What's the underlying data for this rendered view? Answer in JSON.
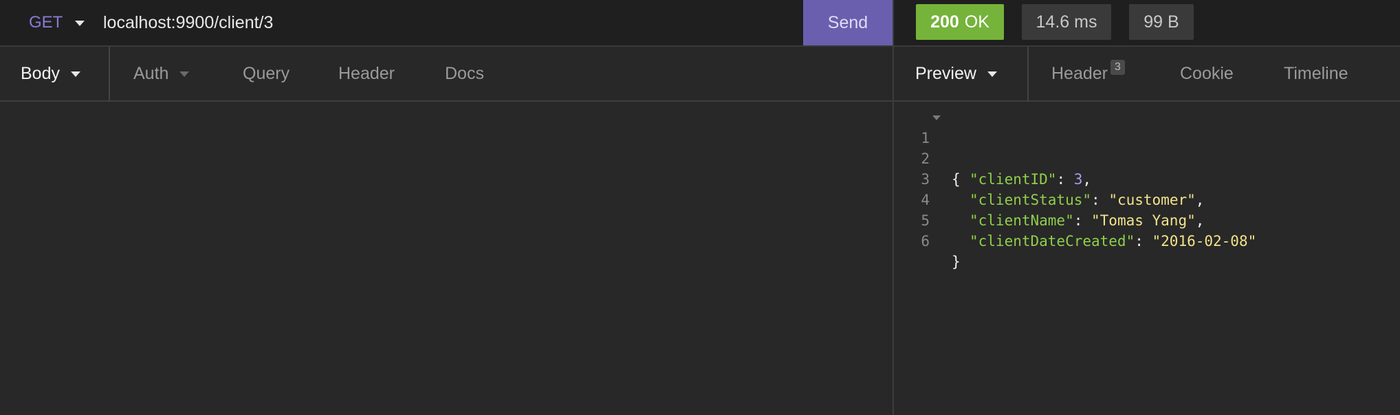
{
  "request": {
    "method": "GET",
    "url": "localhost:9900/client/3",
    "send_label": "Send",
    "tabs": {
      "body": "Body",
      "auth": "Auth",
      "query": "Query",
      "header": "Header",
      "docs": "Docs"
    }
  },
  "response": {
    "status_code": "200",
    "status_text": "OK",
    "time": "14.6 ms",
    "size": "99 B",
    "status_color": "#75b33a",
    "tabs": {
      "preview": "Preview",
      "header": "Header",
      "header_count": "3",
      "cookie": "Cookie",
      "timeline": "Timeline"
    },
    "body_lines": [
      {
        "num": "1",
        "open": "{"
      },
      {
        "num": "2",
        "key": "\"clientID\"",
        "sep": ": ",
        "value": "3",
        "end": ","
      },
      {
        "num": "3",
        "key": "\"clientStatus\"",
        "sep": ": ",
        "value": "\"customer\"",
        "end": ","
      },
      {
        "num": "4",
        "key": "\"clientName\"",
        "sep": ": ",
        "value": "\"Tomas Yang\"",
        "end": ","
      },
      {
        "num": "5",
        "key": "\"clientDateCreated\"",
        "sep": ": ",
        "value": "\"2016-02-08\"",
        "end": ""
      },
      {
        "num": "6",
        "close": "}"
      }
    ]
  },
  "theme": {
    "accent": "#6a5fae",
    "method_color": "#8a7bd4",
    "key_color": "#8fcf4a",
    "string_color": "#f3e38a",
    "number_color": "#a99cf0"
  }
}
